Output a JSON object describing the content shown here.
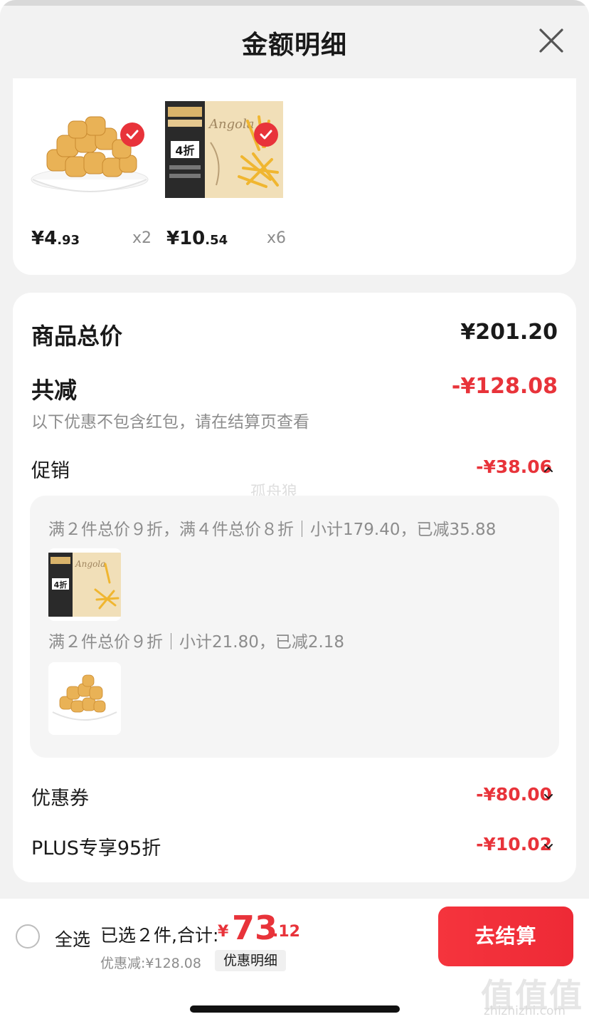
{
  "header": {
    "title": "金额明细",
    "close_icon": "close-icon"
  },
  "products": [
    {
      "name": "fish-tofu",
      "price_int": "¥4",
      "price_dec": ".93",
      "qty": "x2",
      "checked": true
    },
    {
      "name": "angola-fries",
      "price_int": "¥10",
      "price_dec": ".54",
      "qty": "x6",
      "checked": true
    }
  ],
  "summary": {
    "total_label": "商品总价",
    "total_value": "¥201.20",
    "reduce_label": "共减",
    "reduce_value": "-¥128.08",
    "note": "以下优惠不包含红包，请在结算页查看",
    "promo_label": "促销",
    "promo_value": "-¥38.06",
    "watermark": "孤舟狼",
    "promo_lines": [
      "满２件总价９折，满４件总价８折｜小计179.40，已减35.88",
      "满２件总价９折｜小计21.80，已减2.18"
    ],
    "coupon_label": "优惠券",
    "coupon_value": "-¥80.00",
    "plus_label": "PLUS专享95折",
    "plus_value": "-¥10.02"
  },
  "bottom": {
    "select_all": "全选",
    "selected": "已选２件,合计:",
    "sum_sign": "¥",
    "sum_int": "73",
    "sum_dec": ".12",
    "discount_line": "优惠减:¥128.08",
    "detail_chip": "优惠明细",
    "checkout": "去结算"
  },
  "brand": {
    "glyphs": "值值值",
    "url": "zhizhizhi.com"
  },
  "colors": {
    "accent_red": "#e8333a",
    "muted_gray": "#8c8c8c",
    "sheet_bg": "#f2f2f2"
  }
}
